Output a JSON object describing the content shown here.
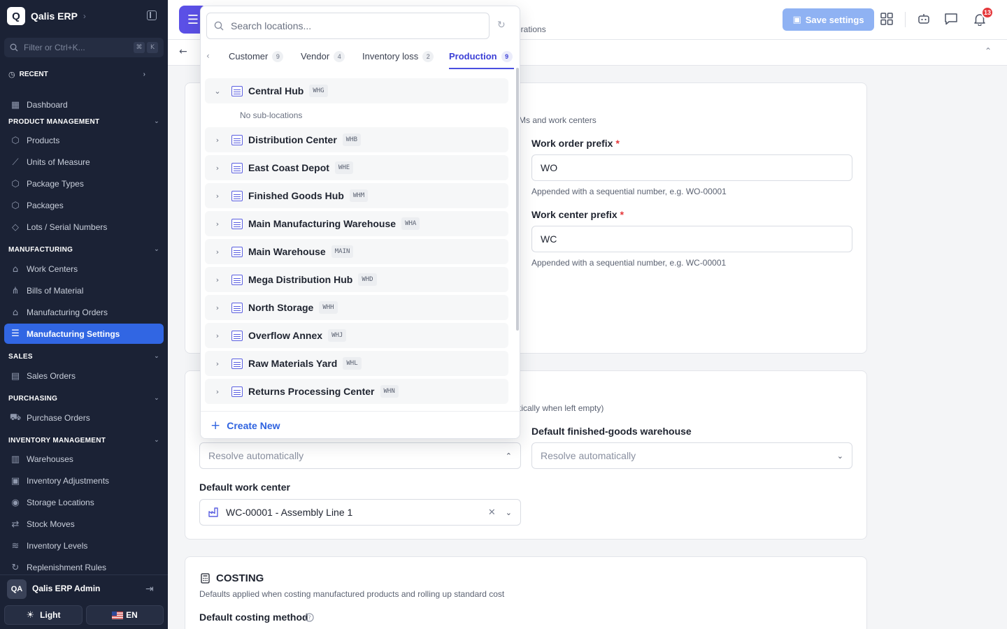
{
  "app": {
    "logo_letter": "Q",
    "name": "Qalis ERP",
    "filter_placeholder": "Filter or Ctrl+K...",
    "kbd_keys": [
      "⌘",
      "K"
    ],
    "recent_label": "RECENT"
  },
  "sidebar": {
    "dashboard": "Dashboard",
    "sections": {
      "product": {
        "title": "PRODUCT MANAGEMENT",
        "items": [
          "Products",
          "Units of Measure",
          "Package Types",
          "Packages",
          "Lots / Serial Numbers"
        ]
      },
      "manufacturing": {
        "title": "MANUFACTURING",
        "items": [
          "Work Centers",
          "Bills of Material",
          "Manufacturing Orders",
          "Manufacturing Settings"
        ]
      },
      "sales": {
        "title": "SALES",
        "items": [
          "Sales Orders"
        ]
      },
      "purchasing": {
        "title": "PURCHASING",
        "items": [
          "Purchase Orders"
        ]
      },
      "inventory": {
        "title": "INVENTORY MANAGEMENT",
        "items": [
          "Warehouses",
          "Inventory Adjustments",
          "Storage Locations",
          "Stock Moves",
          "Inventory Levels",
          "Replenishment Rules"
        ]
      }
    },
    "active_item": "Manufacturing Settings",
    "user": {
      "initials": "QA",
      "name": "Qalis ERP Admin"
    },
    "theme_label": "Light",
    "lang_label": "EN"
  },
  "header": {
    "subtitle_fragment": "erations",
    "save_label": "Save settings",
    "notification_count": "13"
  },
  "numbering": {
    "desc_fragment": "Ms and work centers",
    "work_order_label": "Work order prefix",
    "work_order_value": "WO",
    "work_order_help": "Appended with a sequential number, e.g. WO-00001",
    "work_center_label": "Work center prefix",
    "work_center_value": "WC",
    "work_center_help": "Appended with a sequential number, e.g. WC-00001",
    "required_mark": "*"
  },
  "defaults": {
    "desc_fragment": "tically when left empty)",
    "source_select_value": "Resolve automatically",
    "fg_warehouse_label": "Default finished-goods warehouse",
    "fg_warehouse_value": "Resolve automatically",
    "work_center_label": "Default work center",
    "work_center_value": "WC-00001 - Assembly Line 1"
  },
  "costing": {
    "title": "COSTING",
    "description": "Defaults applied when costing manufactured products and rolling up standard cost",
    "method_label": "Default costing method"
  },
  "popover": {
    "search_placeholder": "Search locations...",
    "tabs": [
      {
        "label": "Customer",
        "count": "9"
      },
      {
        "label": "Vendor",
        "count": "4"
      },
      {
        "label": "Inventory loss",
        "count": "2"
      },
      {
        "label": "Production",
        "count": "9"
      }
    ],
    "active_tab": "Production",
    "expanded": {
      "name": "Central Hub",
      "code": "WHG",
      "empty_text": "No sub-locations"
    },
    "locations": [
      {
        "name": "Distribution Center",
        "code": "WHB"
      },
      {
        "name": "East Coast Depot",
        "code": "WHE"
      },
      {
        "name": "Finished Goods Hub",
        "code": "WHM"
      },
      {
        "name": "Main Manufacturing Warehouse",
        "code": "WHA"
      },
      {
        "name": "Main Warehouse",
        "code": "MAIN"
      },
      {
        "name": "Mega Distribution Hub",
        "code": "WHD"
      },
      {
        "name": "North Storage",
        "code": "WHH"
      },
      {
        "name": "Overflow Annex",
        "code": "WHJ"
      },
      {
        "name": "Raw Materials Yard",
        "code": "WHL"
      },
      {
        "name": "Returns Processing Center",
        "code": "WHN"
      }
    ],
    "create_label": "Create New"
  },
  "colors": {
    "sidebar_bg": "#1b2235",
    "active_item": "#3166e3",
    "accent": "#4a4fe0",
    "save_button": "#8fb2f3",
    "badge": "#e5383b"
  },
  "icons": {
    "brand": "logo-icon",
    "filter": "search-icon",
    "recent": "clock-icon",
    "save": "save-icon",
    "apps": "grid-icon",
    "bot": "bot-icon",
    "chat": "message-icon",
    "bell": "bell-icon",
    "location": "warehouse-icon",
    "refresh": "refresh-icon"
  }
}
